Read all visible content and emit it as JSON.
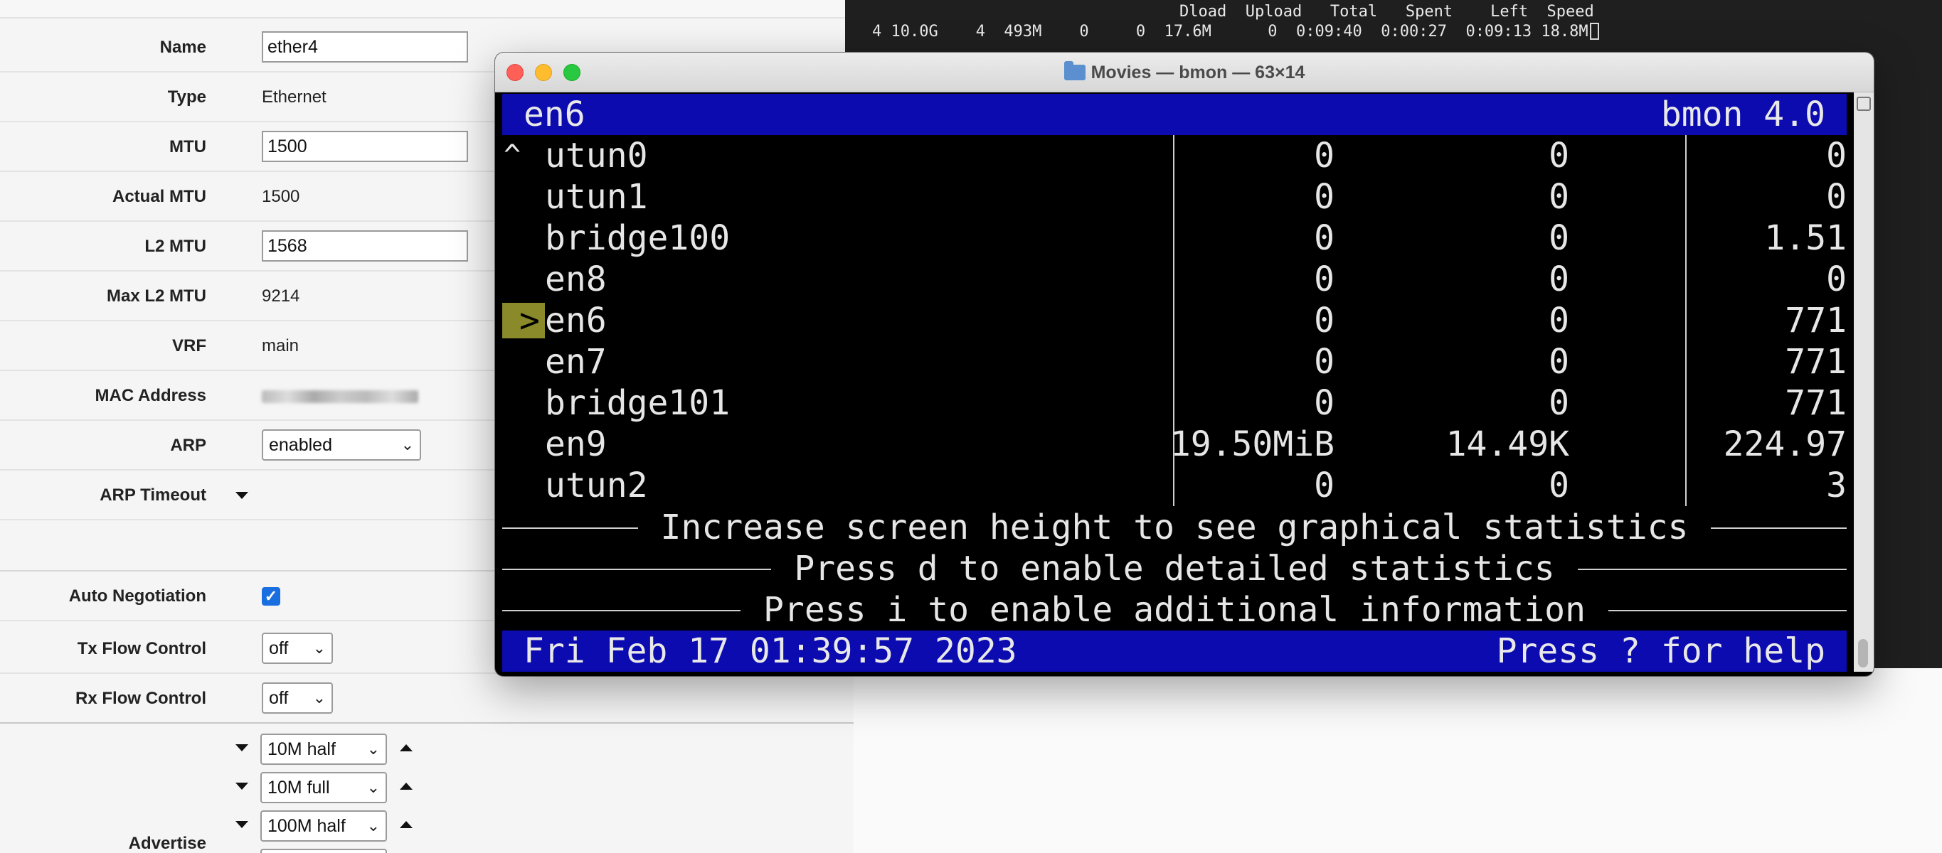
{
  "form": {
    "fields": [
      {
        "label": "Name",
        "value": "ether4"
      },
      {
        "label": "Type",
        "value": "Ethernet"
      },
      {
        "label": "MTU",
        "value": "1500"
      },
      {
        "label": "Actual MTU",
        "value": "1500"
      },
      {
        "label": "L2 MTU",
        "value": "1568"
      },
      {
        "label": "Max L2 MTU",
        "value": "9214"
      },
      {
        "label": "VRF",
        "value": "main"
      },
      {
        "label": "MAC Address",
        "value": ""
      },
      {
        "label": "ARP",
        "value": "enabled"
      },
      {
        "label": "ARP Timeout",
        "value": ""
      },
      {
        "label": "Auto Negotiation",
        "value": "checked"
      },
      {
        "label": "Tx Flow Control",
        "value": "off"
      },
      {
        "label": "Rx Flow Control",
        "value": "off"
      },
      {
        "label": "Advertise",
        "options": [
          "10M half",
          "10M full",
          "100M half"
        ]
      }
    ]
  },
  "bg_terminal": {
    "header": "Dload  Upload   Total   Spent    Left  Speed",
    "line": "4 10.0G    4  493M    0     0  17.6M      0  0:09:40  0:00:27  0:09:13 18.8M"
  },
  "window": {
    "title": "Movies — bmon — 63×14",
    "header_left": "en6",
    "header_right": "bmon 4.0",
    "scroll_marker": "^",
    "selected_marker": ">",
    "interfaces": [
      {
        "name": "utun0",
        "a": "0",
        "b": "0",
        "c": "0"
      },
      {
        "name": "utun1",
        "a": "0",
        "b": "0",
        "c": "0"
      },
      {
        "name": "bridge100",
        "a": "0",
        "b": "0",
        "c": "1.51"
      },
      {
        "name": "en8",
        "a": "0",
        "b": "0",
        "c": "0"
      },
      {
        "name": "en6",
        "a": "0",
        "b": "0",
        "c": "771"
      },
      {
        "name": "en7",
        "a": "0",
        "b": "0",
        "c": "771"
      },
      {
        "name": "bridge101",
        "a": "0",
        "b": "0",
        "c": "771"
      },
      {
        "name": "en9",
        "a": "19.50MiB",
        "b": "14.49K",
        "c": "224.97"
      },
      {
        "name": "utun2",
        "a": "0",
        "b": "0",
        "c": "3"
      }
    ],
    "messages": [
      "Increase screen height to see graphical statistics",
      "Press d to enable detailed statistics",
      "Press i to enable additional information"
    ],
    "footer_left": "Fri Feb 17 01:39:57 2023",
    "footer_right": "Press ? for help"
  },
  "colors": {
    "bmon_bar": "#0b0bb0",
    "selection": "#8a8a2a",
    "checkbox": "#1a6fe0"
  }
}
